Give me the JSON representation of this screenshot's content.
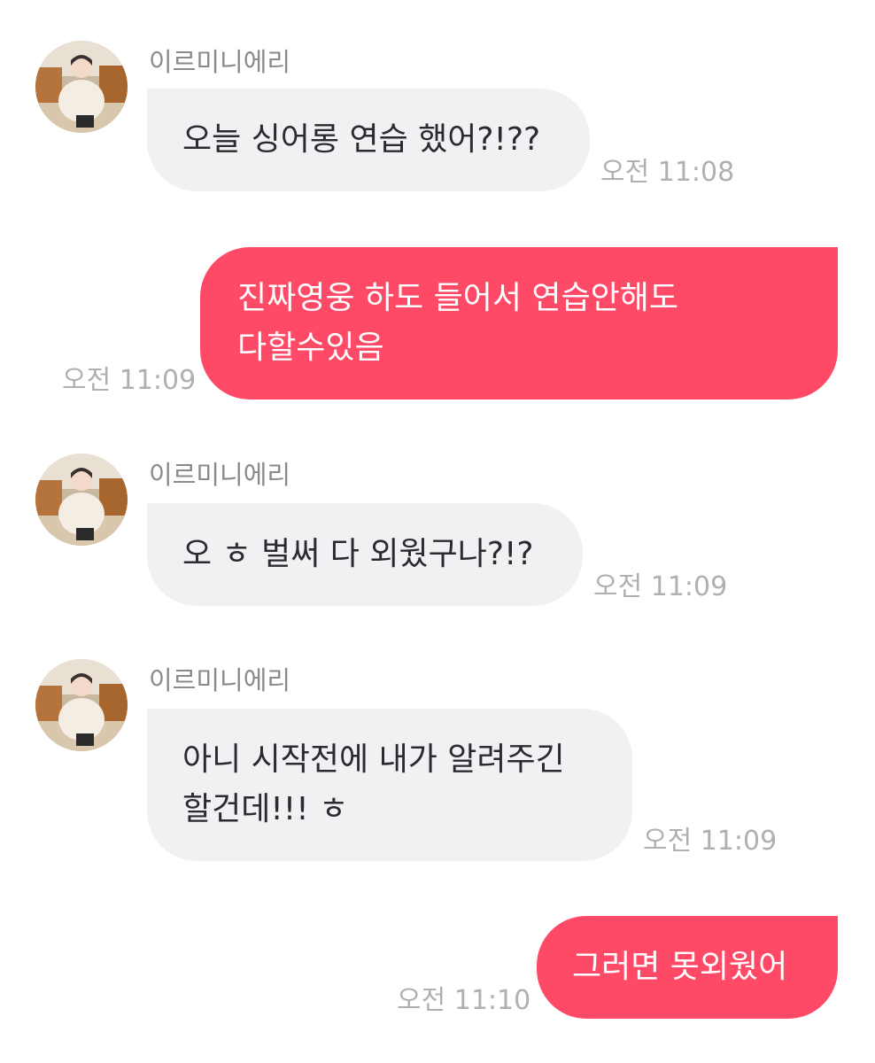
{
  "messages": [
    {
      "sender": "이르미니에리",
      "lines": [
        "오늘 싱어롱 연습 했어?!??"
      ],
      "time": "오전 11:08"
    },
    {
      "lines": [
        "진짜영웅 하도 들어서 연습안해도",
        "다할수있음"
      ],
      "time": "오전 11:09"
    },
    {
      "sender": "이르미니에리",
      "lines": [
        "오 ㅎ 벌써 다 외웠구나?!?"
      ],
      "time": "오전 11:09"
    },
    {
      "sender": "이르미니에리",
      "lines": [
        "아니 시작전에 내가 알려주긴",
        "할건데!!! ㅎ"
      ],
      "time": "오전 11:09"
    },
    {
      "lines": [
        "그러면 못외웠어"
      ],
      "time": "오전 11:10"
    }
  ],
  "colors": {
    "incoming_bubble": "#f1f1f3",
    "outgoing_bubble": "#fe4a67",
    "timestamp": "#b0b0b4",
    "sender_name": "#8a8a8e"
  },
  "icons": {
    "avatar": "profile-photo-avatar-icon"
  }
}
